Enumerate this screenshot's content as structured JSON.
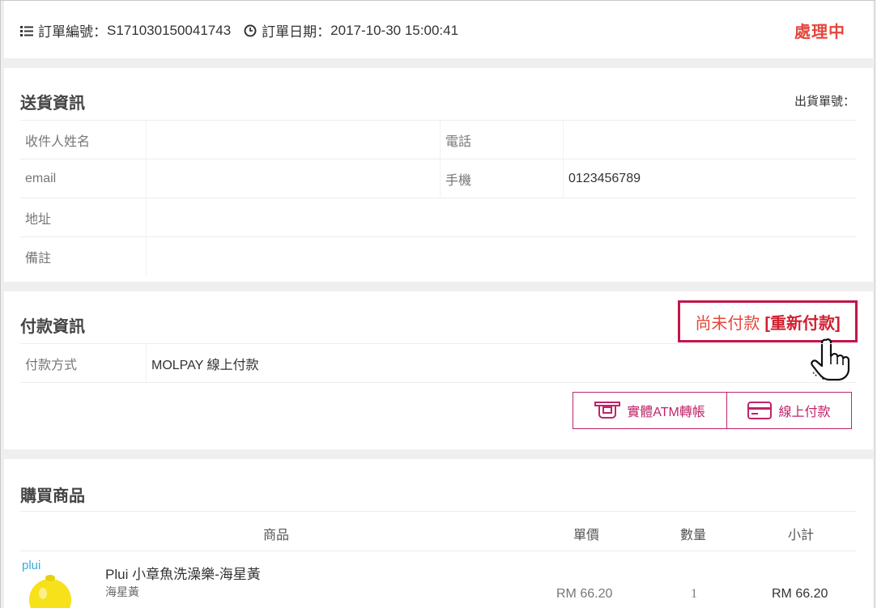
{
  "header": {
    "order_no_label": "訂單編號：",
    "order_no": "S171030150041743",
    "order_date_label": "訂單日期：",
    "order_date": "2017-10-30 15:00:41",
    "status": "處理中"
  },
  "shipping": {
    "title": "送貨資訊",
    "shipment_no_label": "出貨單號：",
    "fields": {
      "recipient_label": "收件人姓名",
      "recipient_value": "",
      "phone_label": "電話",
      "phone_value": "",
      "email_label": "email",
      "email_value": "",
      "mobile_label": "手機",
      "mobile_value": "0123456789",
      "address_label": "地址",
      "address_value": "",
      "note_label": "備註",
      "note_value": ""
    }
  },
  "payment": {
    "title": "付款資訊",
    "unpaid_text": "尚未付款",
    "repay_link": "[重新付款]",
    "method_label": "付款方式",
    "method_value": "MOLPAY 線上付款",
    "atm_button": "實體ATM轉帳",
    "online_button": "線上付款",
    "accent_color": "#c0246a",
    "highlight_color": "#e4463b"
  },
  "items": {
    "title": "購買商品",
    "columns": {
      "product": "商品",
      "unit_price": "單價",
      "quantity": "數量",
      "subtotal": "小計"
    },
    "rows": [
      {
        "brand": "plui",
        "name": "Plui 小章魚洗澡樂-海星黃",
        "variant": "海星黃",
        "unit_price": "RM 66.20",
        "quantity": "1",
        "subtotal": "RM 66.20"
      }
    ]
  }
}
